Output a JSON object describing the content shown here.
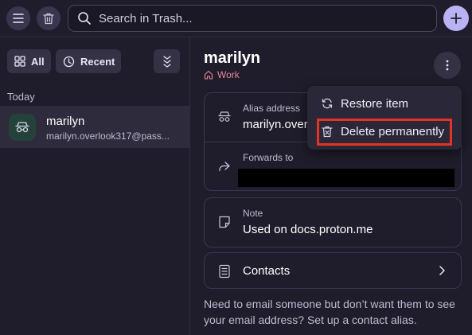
{
  "search": {
    "placeholder": "Search in Trash..."
  },
  "filters": {
    "all_label": "All",
    "recent_label": "Recent"
  },
  "list": {
    "section": "Today",
    "items": [
      {
        "title": "marilyn",
        "subtitle": "marilyn.overlook317@pass..."
      }
    ]
  },
  "detail": {
    "title": "marilyn",
    "vault": "Work",
    "alias_label": "Alias address",
    "alias_value": "marilyn.overlook317@passinbox.com",
    "forwards_label": "Forwards to",
    "note_label": "Note",
    "note_value": "Used on docs.proton.me",
    "contacts_label": "Contacts",
    "hint": "Need to email someone but don’t want them to see your email address? Set up a contact alias."
  },
  "menu": {
    "restore_label": "Restore item",
    "delete_label": "Delete permanently"
  },
  "colors": {
    "background": "#1f1d2b",
    "accent": "#b9b3f5",
    "vault": "#e8869a",
    "highlight": "#e53322"
  }
}
